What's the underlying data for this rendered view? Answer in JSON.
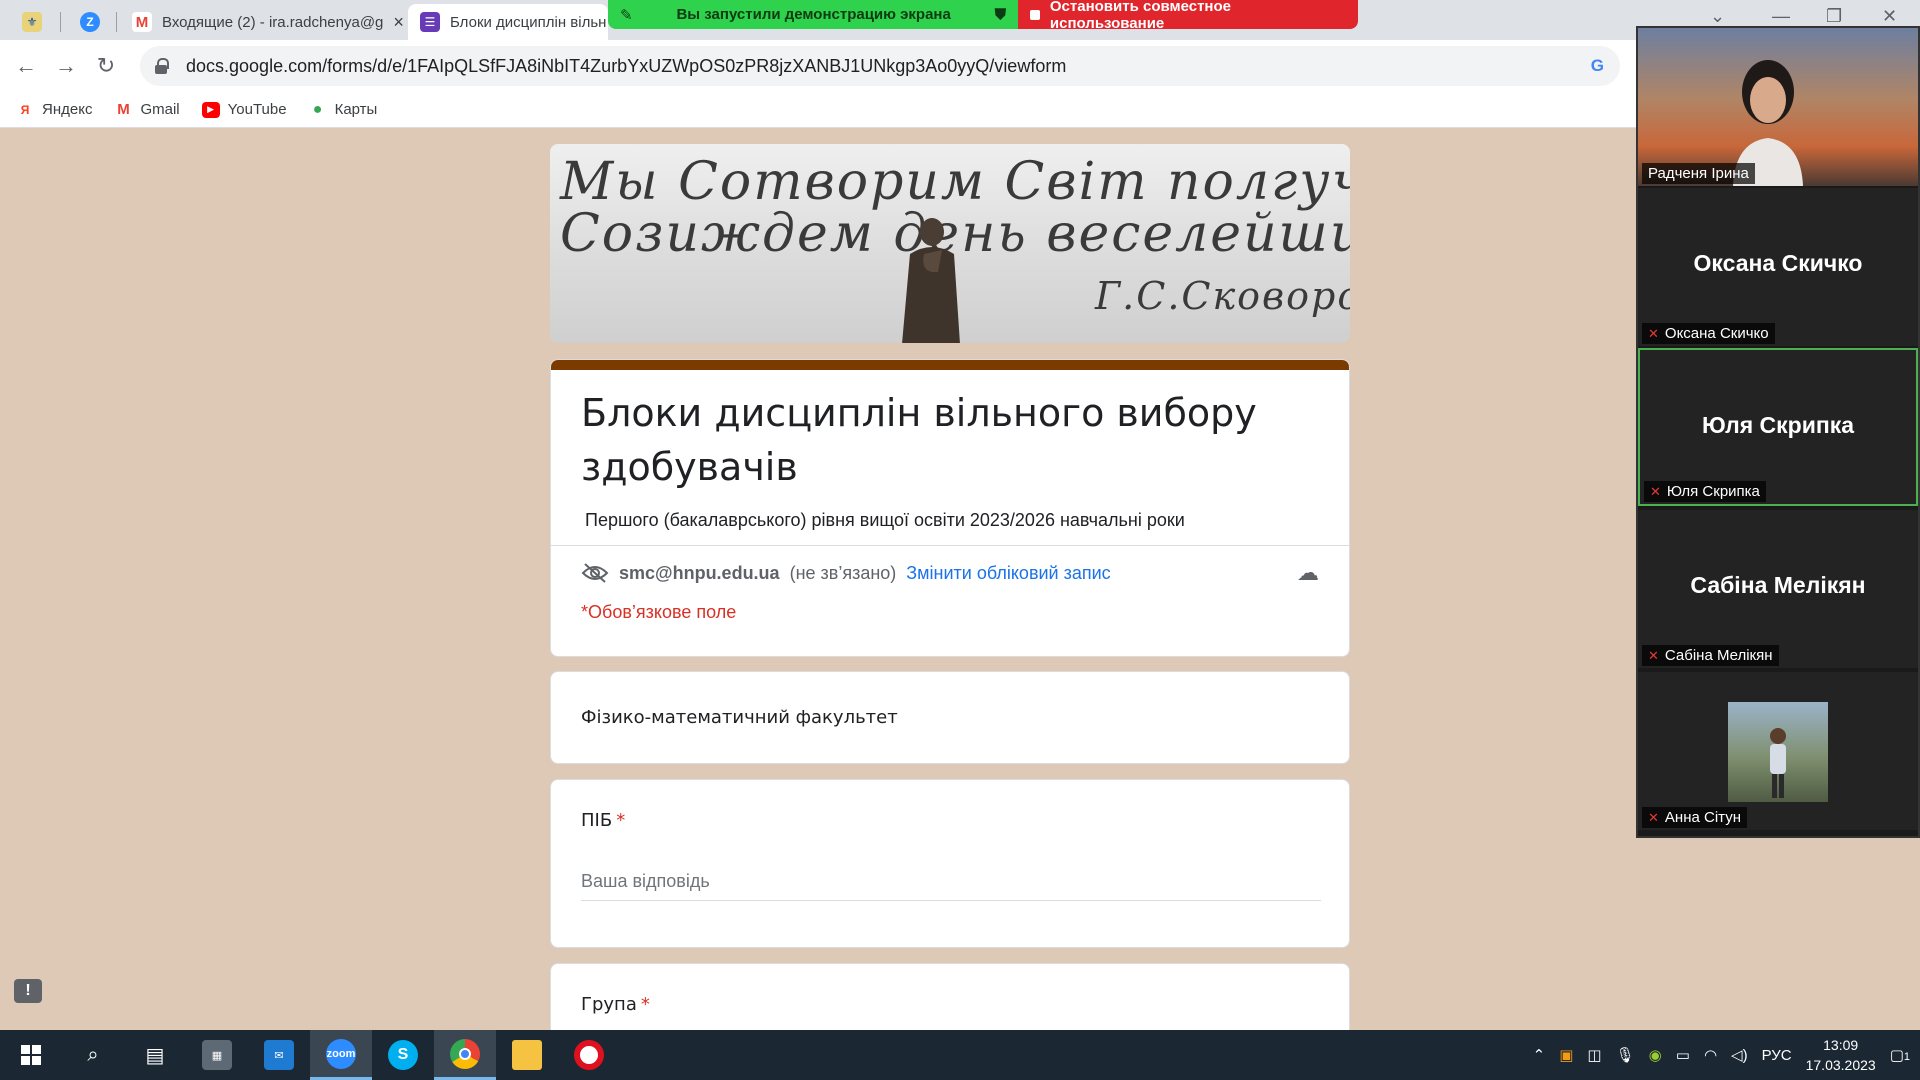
{
  "browser": {
    "tabs": [
      {
        "label": "",
        "icon": "ukraine-emblem-icon"
      },
      {
        "label": "",
        "icon": "zoom-icon"
      },
      {
        "label": "Входящие (2) - ira.radchenya@g",
        "icon": "gmail-icon"
      },
      {
        "label": "Блоки дисциплін вільн",
        "icon": "google-forms-icon"
      }
    ],
    "url": "docs.google.com/forms/d/e/1FAIpQLSfFJA8iNbIT4ZurbYxUZWpOS0zPR8jzXANBJ1UNkgp3Ao0yyQ/viewform",
    "bookmarks": [
      {
        "label": "Яндекс",
        "icon": "yandex-icon",
        "color": "#fc3f1d"
      },
      {
        "label": "Gmail",
        "icon": "gmail-icon",
        "color": "#ea4335"
      },
      {
        "label": "YouTube",
        "icon": "youtube-icon",
        "color": "#ff0000"
      },
      {
        "label": "Карты",
        "icon": "maps-icon",
        "color": "#34a853"
      }
    ]
  },
  "share_bar": {
    "status": "Вы запустили демонстрацию экрана",
    "stop": "Остановить совместное использование",
    "status_color": "#2ed24d",
    "stop_color": "#e0262c"
  },
  "form": {
    "banner_line1": "Мы Сотворим Світ полгучшій",
    "banner_line2": "Созиждем день веселейший.",
    "banner_line3": "Г.С.Сковорода",
    "title": "Блоки дисциплін вільного вибору здобувачів",
    "description": "Першого (бакалаврського) рівня вищої освіти 2023/2026 навчальні роки",
    "account_email": "smc@hnpu.edu.ua",
    "account_status": "(не зв’язано)",
    "switch_account": "Змінити обліковий запис",
    "required_note": "*Обов’язкове поле",
    "section_title": "Фізико-математичний факультет",
    "questions": [
      {
        "label": "ПІБ",
        "required": "*",
        "placeholder": "Ваша відповідь"
      },
      {
        "label": "Група",
        "required": "*"
      }
    ],
    "accent_color": "#7b3b00",
    "background_color": "#ddc9b6"
  },
  "zoom": {
    "participants": [
      {
        "name": "Радченя Ірина",
        "video": true
      },
      {
        "name": "Оксана Скичко",
        "big_name": "Оксана Скичко",
        "muted": true
      },
      {
        "name": "Юля Скрипка",
        "big_name": "Юля Скрипка",
        "muted": true,
        "active_speaker": true
      },
      {
        "name": "Сабіна Мелікян",
        "big_name": "Сабіна Мелікян",
        "muted": true
      },
      {
        "name": "Анна Сітун",
        "muted": true,
        "avatar_photo": true
      }
    ]
  },
  "taskbar": {
    "apps": [
      "windows-start-icon",
      "search-icon",
      "task-view-icon",
      "calculator-icon",
      "mail-icon",
      "zoom-icon",
      "skype-icon",
      "chrome-icon",
      "file-explorer-icon",
      "opera-icon"
    ],
    "language": "РУС",
    "time": "13:09",
    "date": "17.03.2023",
    "notifications": "1"
  }
}
